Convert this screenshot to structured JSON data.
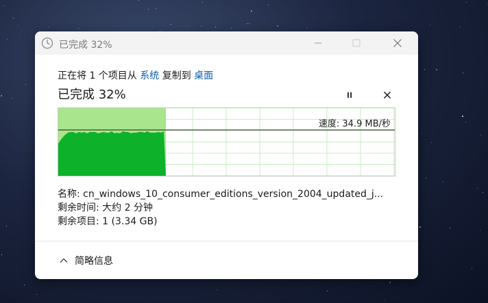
{
  "window": {
    "title": "已完成 32%",
    "controls": [
      "minimize-icon",
      "maximize-icon",
      "close-icon"
    ]
  },
  "transfer": {
    "prefix": "正在将 1 个项目从 ",
    "source": "系统",
    "middle": " 复制到 ",
    "destination": "桌面",
    "status": "已完成 32%",
    "progress_percent": 32,
    "speed_label": "速度: 34.9 MB/秒"
  },
  "details": {
    "name": "名称: cn_windows_10_consumer_editions_version_2004_updated_j...",
    "time_remaining": "剩余时间: 大约 2 分钟",
    "items_remaining": "剩余项目: 1 (3.34 GB)"
  },
  "footer": {
    "toggle_label": "简略信息",
    "icon": "chevron-up-icon"
  },
  "colors": {
    "accent_link": "#0b5cad",
    "progress_fill": "#a8e58c",
    "speed_area": "#0db12a",
    "grid_line": "#c8ecc0"
  }
}
